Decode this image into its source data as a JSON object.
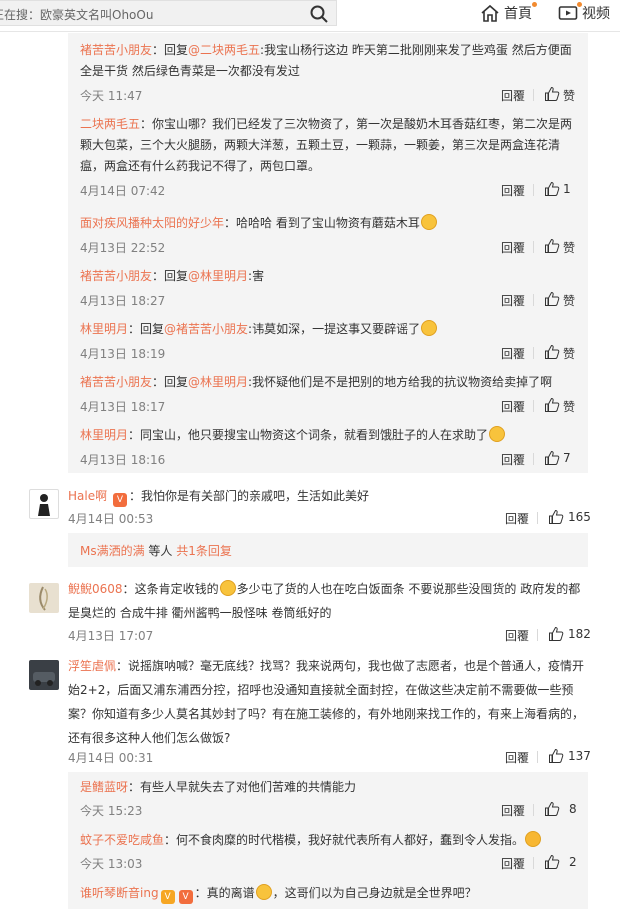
{
  "search": {
    "text": "正在搜：欧豪英文名叫OhoOu"
  },
  "nav": {
    "home": "首頁",
    "video": "视频"
  },
  "reply_label": "回覆",
  "thread1": [
    {
      "user": "褚苦苦小朋友",
      "text_pre": "：回复",
      "mention": "@二块两毛五",
      "text": ":我宝山杨行这边 昨天第二批刚刚来发了些鸡蛋 然后方便面全是干货 然后绿色青菜是一次都没有发过",
      "time": "今天 11:47",
      "likes": "赞"
    },
    {
      "user": "二块两毛五",
      "text_pre": "：",
      "mention": "",
      "text": "你宝山哪？我们已经发了三次物资了，第一次是酸奶木耳香菇红枣，第二次是两颗大包菜，三个大火腿肠，两颗大洋葱，五颗土豆，一颗蒜，一颗姜，第三次是两盒连花清瘟，两盒还有什么药我记不得了，两包口罩。",
      "time": "4月14日 07:42",
      "likes": "1"
    },
    {
      "user": "面对疾风播种太阳的好少年",
      "text_pre": "：",
      "mention": "",
      "text": "哈哈哈 看到了宝山物资有蘑菇木耳",
      "time": "4月13日 22:52",
      "likes": "赞"
    },
    {
      "user": "褚苦苦小朋友",
      "text_pre": "：回复",
      "mention": "@林里明月",
      "text": ":害",
      "time": "4月13日 18:27",
      "likes": "赞"
    },
    {
      "user": "林里明月",
      "text_pre": "：回复",
      "mention": "@褚苦苦小朋友",
      "text": ":讳莫如深，一提这事又要辟谣了",
      "time": "4月13日 18:19",
      "likes": "赞"
    },
    {
      "user": "褚苦苦小朋友",
      "text_pre": "：回复",
      "mention": "@林里明月",
      "text": ":我怀疑他们是不是把别的地方给我的抗议物资给卖掉了啊",
      "time": "4月13日 18:17",
      "likes": "赞"
    },
    {
      "user": "林里明月",
      "text_pre": "：",
      "mention": "",
      "text": "同宝山，他只要搜宝山物资这个词条，就看到饿肚子的人在求助了",
      "time": "4月13日 18:16",
      "likes": "7"
    }
  ],
  "comments": [
    {
      "user": "Hale啊",
      "text": "我怕你是有关部门的亲戚吧，生活如此美好",
      "time": "4月14日 00:53",
      "likes": "165"
    },
    {
      "user": "鲵鲵0608",
      "text": "这条肯定收钱的",
      "text2": "多少屯了货的人也在吃白饭面条 不要说那些没囤货的 政府发的都是臭烂的 合成牛排 衢州酱鸭一股怪味 卷筒纸好的",
      "time": "4月13日 17:07",
      "likes": "182"
    },
    {
      "user": "浮笙虐佩",
      "text": "说摇旗呐喊？毫无底线？找骂？我来说两句，我也做了志愿者，也是个普通人，疫情开始2+2，后面又浦东浦西分控，招呼也没通知直接就全面封控，在做这些决定前不需要做一些预案？你知道有多少人莫名其妙封了吗？有在施工装修的，有外地刚来找工作的，有来上海看病的，还有很多这种人他们怎么做饭?",
      "time": "4月14日 00:31",
      "likes": "137"
    }
  ],
  "expand": {
    "user": "Ms满洒的满",
    "middle": " 等人 ",
    "count": "共1条回复"
  },
  "thread2": [
    {
      "user": "是鳍蓝呀",
      "text": "有些人早就失去了对他们苦难的共情能力",
      "time": "今天 15:23",
      "likes": "8"
    },
    {
      "user": "蚊子不爱吃咸鱼",
      "text": "何不食肉糜的时代楷模，我好就代表所有人都好，蠢到令人发指。",
      "time": "今天 13:03",
      "likes": "2"
    },
    {
      "user": "谁听琴断音ing",
      "text": "真的离谱",
      "text2": "，这哥们以为自己身边就是全世界吧？",
      "time": "",
      "likes": ""
    }
  ],
  "colors": {
    "accent": "#eb7350",
    "reply_bg": "#f4f4f4",
    "meta": "#808080"
  }
}
